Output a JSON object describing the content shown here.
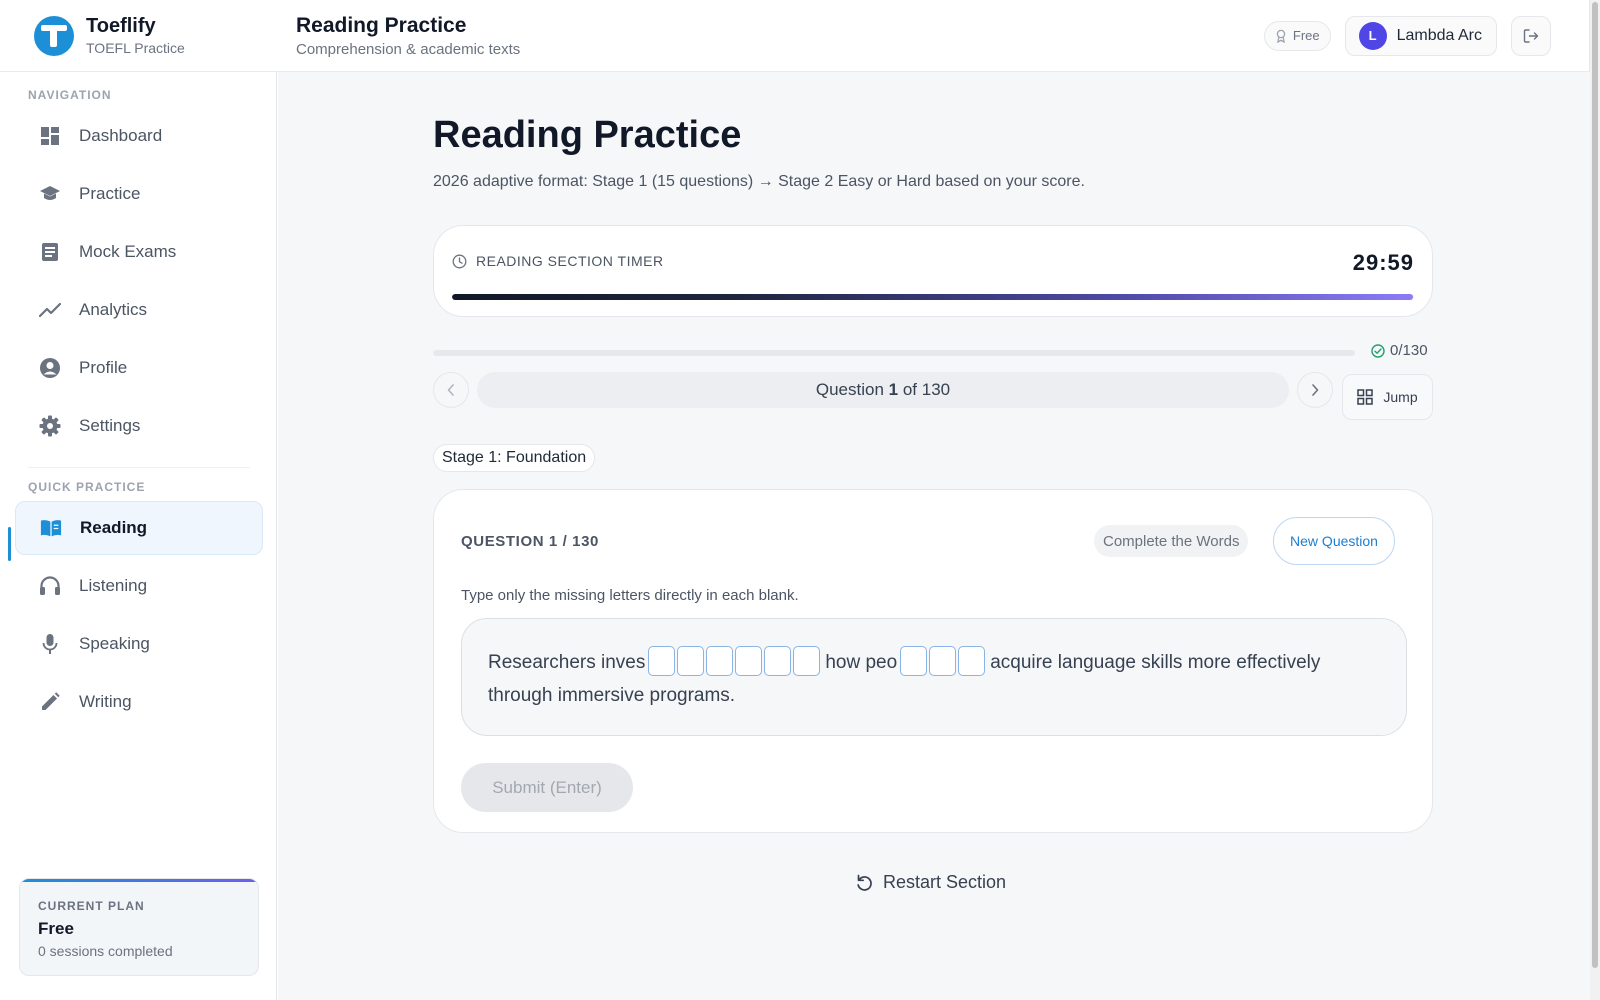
{
  "app": {
    "name": "Toeflify",
    "subtitle": "TOEFL Practice"
  },
  "header": {
    "title": "Reading Practice",
    "subtitle": "Comprehension & academic texts",
    "plan_badge": "Free",
    "user_name": "Lambda Arc",
    "user_initial": "L"
  },
  "sidebar": {
    "nav_heading": "NAVIGATION",
    "nav_items": [
      {
        "label": "Dashboard",
        "icon": "dashboard-icon"
      },
      {
        "label": "Practice",
        "icon": "graduation-cap-icon"
      },
      {
        "label": "Mock Exams",
        "icon": "document-icon"
      },
      {
        "label": "Analytics",
        "icon": "trend-line-icon"
      },
      {
        "label": "Profile",
        "icon": "user-circle-icon"
      },
      {
        "label": "Settings",
        "icon": "gear-icon"
      }
    ],
    "quick_heading": "QUICK PRACTICE",
    "quick_items": [
      {
        "label": "Reading",
        "icon": "book-open-icon",
        "active": true
      },
      {
        "label": "Listening",
        "icon": "headphones-icon",
        "active": false
      },
      {
        "label": "Speaking",
        "icon": "microphone-icon",
        "active": false
      },
      {
        "label": "Writing",
        "icon": "pencil-icon",
        "active": false
      }
    ],
    "plan": {
      "label": "CURRENT PLAN",
      "name": "Free",
      "sessions": "0 sessions completed"
    }
  },
  "main": {
    "title": "Reading Practice",
    "description": "2026 adaptive format: Stage 1 (15 questions) → Stage 2 Easy or Hard based on your score.",
    "timer": {
      "label": "READING SECTION TIMER",
      "value": "29:59",
      "fraction_remaining": 0.999
    },
    "progress": {
      "answered": 0,
      "total": 130,
      "text": "0/130"
    },
    "question_nav": {
      "prefix": "Question ",
      "current": "1",
      "suffix": " of 130",
      "jump_label": "Jump"
    },
    "stage_label": "Stage 1: Foundation",
    "question": {
      "title": "QUESTION 1 / 130",
      "type": "Complete the Words",
      "new_button": "New Question",
      "instruction": "Type only the missing letters directly in each blank.",
      "text_part1": "Researchers inves",
      "blanks1": 6,
      "text_part2": "how peo",
      "blanks2": 3,
      "text_part3": "acquire language skills more effectively through immersive programs.",
      "submit_label": "Submit (Enter)"
    },
    "restart_label": "Restart Section"
  },
  "colors": {
    "accent": "#1d8fd6",
    "avatar": "#4f46e5",
    "success": "#22a06b"
  }
}
